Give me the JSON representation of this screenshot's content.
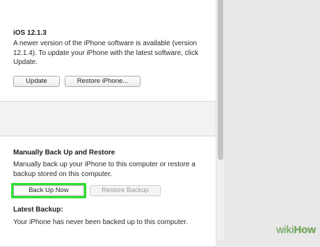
{
  "software": {
    "title": "iOS 12.1.3",
    "description": "A newer version of the iPhone software is available (version 12.1.4). To update your iPhone with the latest software, click Update.",
    "update_label": "Update",
    "restore_label": "Restore iPhone..."
  },
  "backup": {
    "title": "Manually Back Up and Restore",
    "description": "Manually back up your iPhone to this computer or restore a backup stored on this computer.",
    "back_up_now_label": "Back Up Now",
    "restore_backup_label": "Restore Backup",
    "latest_title": "Latest Backup:",
    "latest_text": "Your iPhone has never been backed up to this computer."
  },
  "watermark": {
    "wiki": "wiki",
    "how": "How"
  },
  "colors": {
    "highlight": "#28e42b",
    "watermark_green": "#6aa84f"
  }
}
